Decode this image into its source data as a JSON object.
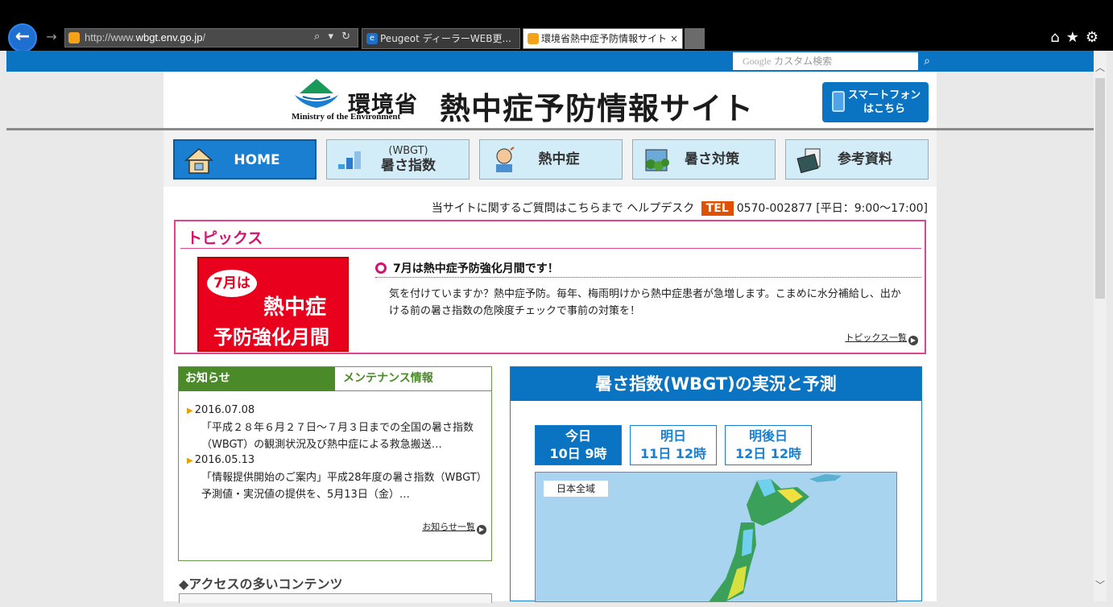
{
  "browser": {
    "url_prefix": "http://www.",
    "url_domain": "wbgt.env.go.jp",
    "url_suffix": "/",
    "addr_controls": "⌕ ▾ ↻",
    "tabs": [
      {
        "title": "Peugeot ディーラーWEB更...",
        "icon": "ie-icon"
      },
      {
        "title": "環境省熱中症予防情報サイト",
        "icon": "site-favicon",
        "active": true
      }
    ],
    "toolbar_icons": [
      "home-icon",
      "favorites-star-icon",
      "settings-gear-icon"
    ]
  },
  "search": {
    "google": "Google",
    "placeholder": "カスタム検索"
  },
  "header": {
    "ministry_jp": "環境省",
    "ministry_en": "Ministry of the Environment",
    "site_title": "熱中症予防情報サイト",
    "smartphone_btn_1": "スマートフォン",
    "smartphone_btn_2": "はこちら"
  },
  "nav": {
    "home": "HOME",
    "wbgt_small": "(WBGT)",
    "wbgt": "暑さ指数",
    "heatstroke": "熱中症",
    "measures": "暑さ対策",
    "references": "参考資料"
  },
  "help": {
    "text": "当サイトに関するご質問はこちらまで ヘルプデスク",
    "tel_label": "TEL",
    "tel_number": "0570-002877",
    "hours": "[平日：9:00～17:00]"
  },
  "topics": {
    "title": "トピックス",
    "image_text_1": "7月は",
    "image_text_2": "熱中症",
    "image_text_3": "予防強化月間",
    "headline": "7月は熱中症予防強化月間です！",
    "body": "気を付けていますか？熱中症予防。毎年、梅雨明けから熱中症患者が急増します。こまめに水分補給し、出かける前の暑さ指数の危険度チェックで事前の対策を！",
    "more": "トピックス一覧"
  },
  "news": {
    "tab_notice": "お知らせ",
    "tab_maintenance": "メンテナンス情報",
    "items": [
      {
        "date": "2016.07.08",
        "text": "「平成２８年６月２７日～７月３日までの全国の暑さ指数（WBGT）の観測状況及び熱中症による救急搬送…"
      },
      {
        "date": "2016.05.13",
        "text": "「情報提供開始のご案内」平成28年度の暑さ指数（WBGT）予測値・実況値の提供を、5月13日（金）…"
      }
    ],
    "more": "お知らせ一覧"
  },
  "access": {
    "title": "◆アクセスの多いコンテンツ"
  },
  "wbgt_panel": {
    "title": "暑さ指数(WBGT)の実況と予測",
    "days": [
      {
        "label": "今日",
        "time": "10日 9時"
      },
      {
        "label": "明日",
        "time": "11日 12時"
      },
      {
        "label": "明後日",
        "time": "12日 12時"
      }
    ],
    "map_region": "日本全域"
  },
  "colors": {
    "brand_blue": "#0b74c2",
    "topics_pink": "#d6126e",
    "news_green": "#4a8a28",
    "tel_orange": "#e05000"
  }
}
